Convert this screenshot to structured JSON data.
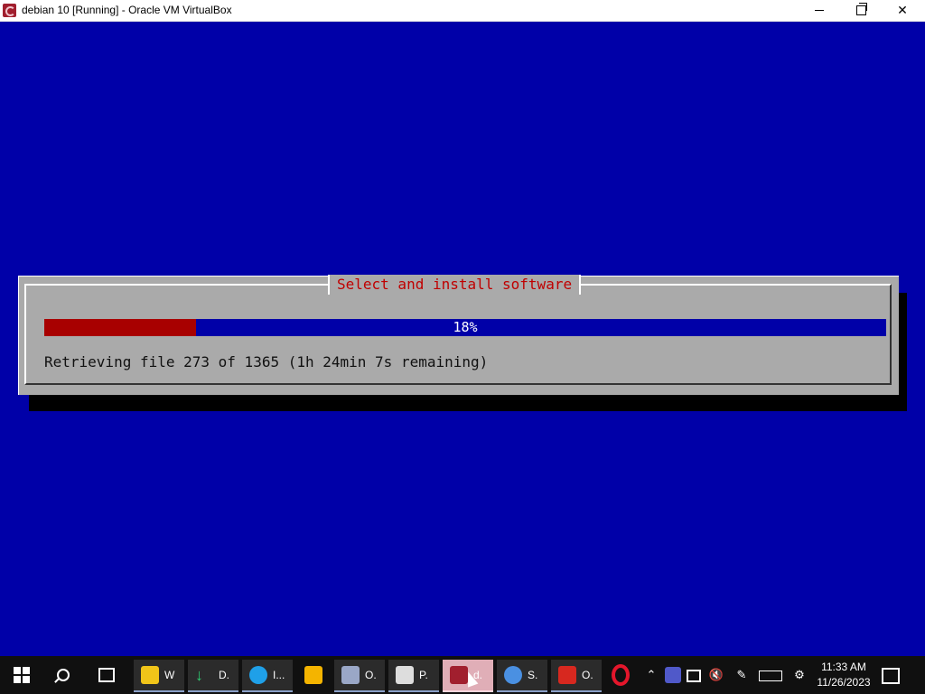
{
  "window": {
    "title": "debian 10 [Running] - Oracle VM VirtualBox",
    "minimize_label": "",
    "maximize_label": "",
    "close_label": "✕"
  },
  "installer": {
    "dialog_title": "Select and install software",
    "progress_percent": 18,
    "progress_label": "18%",
    "status": "Retrieving file 273 of 1365 (1h 24min 7s remaining)"
  },
  "taskbar": {
    "apps": [
      {
        "label": "W",
        "icon": "folder-icon",
        "color": "#f0c419"
      },
      {
        "label": "D.",
        "icon": "download-icon",
        "color": "#2ecc71"
      },
      {
        "label": "I...",
        "icon": "edge-icon",
        "color": "#1fa0e8"
      },
      {
        "label": "",
        "icon": "store-icon",
        "color": "#f4b400"
      },
      {
        "label": "O.",
        "icon": "virtualbox-icon",
        "color": "#9aa7c7"
      },
      {
        "label": "P.",
        "icon": "document-icon",
        "color": "#dddddd"
      },
      {
        "label": "d.",
        "icon": "debian-icon",
        "color": "#a11f2e"
      },
      {
        "label": "S.",
        "icon": "settings-icon",
        "color": "#4a90e2"
      },
      {
        "label": "O.",
        "icon": "acrobat-icon",
        "color": "#d7281f"
      }
    ],
    "clock_time": "11:33 AM",
    "clock_date": "11/26/2023"
  }
}
